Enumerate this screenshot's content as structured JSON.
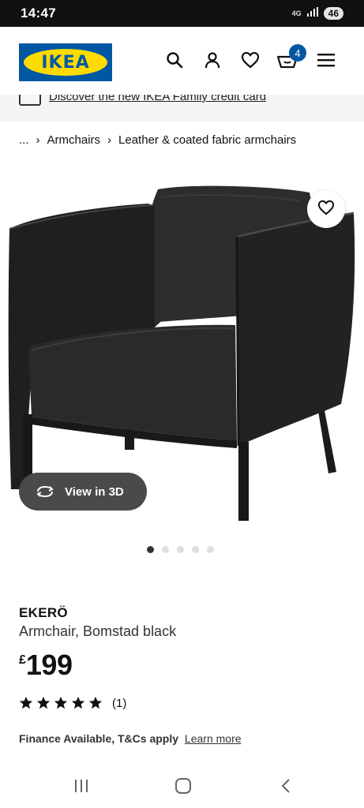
{
  "status_bar": {
    "time": "14:47",
    "network": "4G",
    "battery": "46"
  },
  "header": {
    "logo_text": "IKEA",
    "cart_count": "4",
    "icons": [
      "search-icon",
      "account-icon",
      "heart-icon",
      "cart-icon",
      "menu-icon"
    ]
  },
  "promo": {
    "text": "Discover the new IKEA Family credit card"
  },
  "breadcrumb": {
    "ellipsis": "...",
    "items": [
      "Armchairs",
      "Leather & coated fabric armchairs"
    ]
  },
  "gallery": {
    "view_3d_label": "View in 3D",
    "slide_count": 5,
    "active_slide": 1
  },
  "product": {
    "name": "EKERÖ",
    "description": "Armchair, Bomstad black",
    "currency": "£",
    "price": "199",
    "rating": 5,
    "rating_count": "(1)",
    "finance_text": "Finance Available, T&Cs apply",
    "finance_link": "Learn more"
  },
  "colors": {
    "ikea_blue": "#0058a3",
    "ikea_yellow": "#ffdb00",
    "view3d_bg": "#4a4a4a"
  }
}
